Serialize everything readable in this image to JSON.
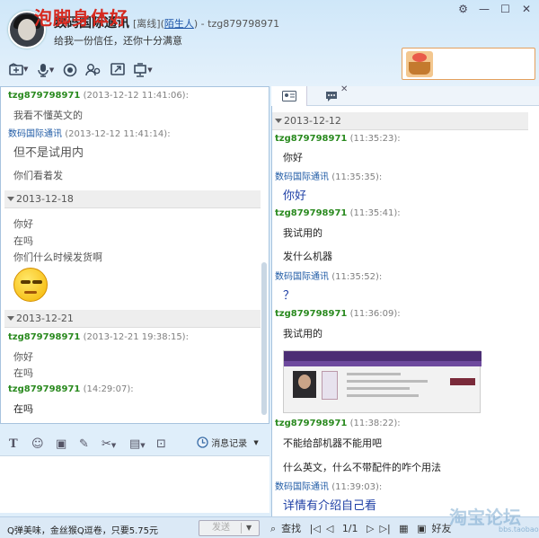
{
  "window": {
    "contact_name": "数码国际通讯",
    "status_prefix": "[离线](",
    "stranger_label": "陌生人",
    "status_suffix": ") - tzg879798971",
    "signature": "给我一份信任，还你十分满意",
    "controls": [
      "⚙",
      "—",
      "☐",
      "✕"
    ]
  },
  "toolbar": {
    "icons": [
      "file-transfer-icon",
      "microphone-icon",
      "camera-icon",
      "contacts-icon",
      "screen-share-icon",
      "remote-assist-icon"
    ]
  },
  "ad_banner": {
    "text": "泡脚身体好"
  },
  "left_chat": {
    "messages": [
      {
        "name": "tzg879798971",
        "time": "(2013-12-12 11:41:06):",
        "text": "我看不懂英文的"
      },
      {
        "name": "数码国际通讯",
        "time": "(2013-12-12 11:41:14):",
        "text": "但不是试用内"
      },
      {
        "text2": "你们看着发"
      }
    ],
    "dates": [
      "2013-12-18",
      "2013-12-21"
    ],
    "msgs_1218": [
      "你好",
      "在吗",
      "你们什么时候发货啊"
    ],
    "msgs_1221": [
      {
        "name": "tzg879798971",
        "time": "(2013-12-21 19:38:15):",
        "lines": [
          "你好",
          "在吗"
        ]
      },
      {
        "name": "tzg879798971",
        "time": "(14:29:07):",
        "lines": [
          "在吗"
        ]
      }
    ]
  },
  "input_toolbar": {
    "history_label": "消息记录"
  },
  "bottom": {
    "ad_line": "Q弹美味，金丝猴Q逗卷，只要5.75元",
    "send_label": "发送",
    "search_label": "查找",
    "page": "1/1",
    "fav_label": "好友",
    "watermark": "淘宝论坛",
    "watermark_url": "bbs.taobao.com"
  },
  "right_chat": {
    "date": "2013-12-12",
    "messages": [
      {
        "name": "tzg879798971",
        "time": "(11:35:23):",
        "lines": [
          "你好"
        ]
      },
      {
        "name": "数码国际通讯",
        "time": "(11:35:35):",
        "lines": [
          "你好"
        ]
      },
      {
        "name": "tzg879798971",
        "time": "(11:35:41):",
        "lines": [
          "我试用的",
          "发什么机器"
        ]
      },
      {
        "name": "数码国际通讯",
        "time": "(11:35:52):",
        "lines": [
          "？"
        ]
      },
      {
        "name": "tzg879798971",
        "time": "(11:36:09):",
        "lines": [
          "我试用的"
        ]
      },
      {
        "name": "tzg879798971",
        "time": "(11:38:22):",
        "lines": [
          "不能给部机器不能用吧",
          "什么英文，什么不带配件的咋个用法"
        ]
      },
      {
        "name": "数码国际通讯",
        "time": "(11:39:03):",
        "lines": [
          "详情有介绍自己看"
        ]
      }
    ]
  }
}
